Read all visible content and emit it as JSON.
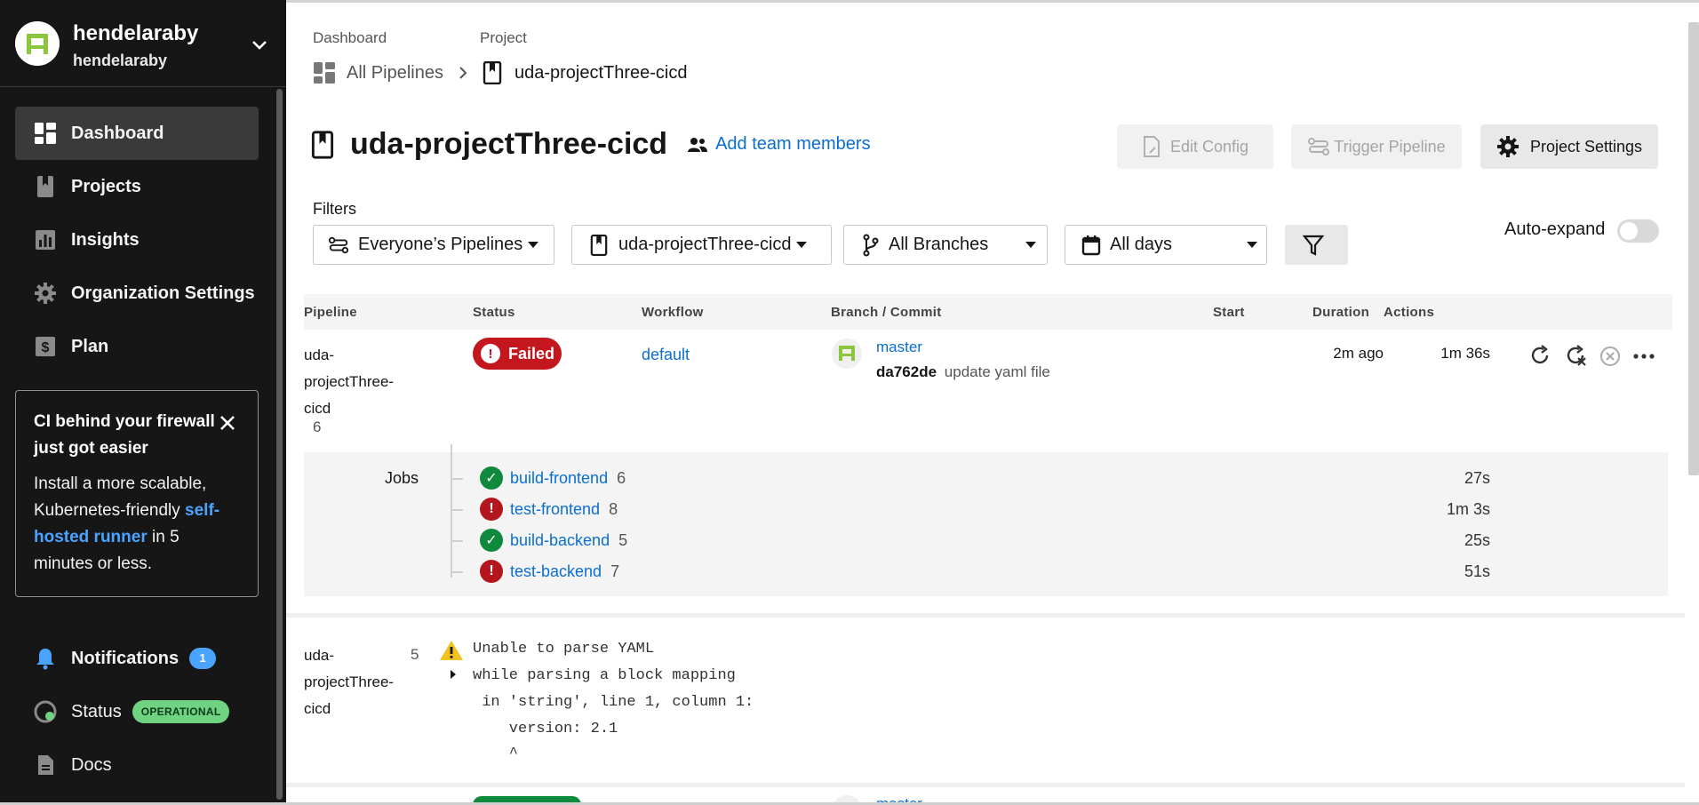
{
  "org": {
    "name": "hendelaraby",
    "sub": "hendelaraby"
  },
  "sidebar": {
    "items": [
      {
        "label": "Dashboard",
        "icon": "dashboard-icon"
      },
      {
        "label": "Projects",
        "icon": "projects-icon"
      },
      {
        "label": "Insights",
        "icon": "insights-icon"
      },
      {
        "label": "Organization Settings",
        "icon": "gear-icon"
      },
      {
        "label": "Plan",
        "icon": "dollar-icon"
      }
    ],
    "promo": {
      "title": "CI behind your firewall just got easier",
      "body_before": "Install a more scalable, Kubernetes-friendly ",
      "link": "self-hosted runner",
      "body_after": " in 5 minutes or less."
    },
    "bottom": {
      "notifications": "Notifications",
      "notifications_count": "1",
      "status": "Status",
      "status_badge": "OPERATIONAL",
      "docs": "Docs"
    }
  },
  "breadcrumb": {
    "dashboard_label": "Dashboard",
    "project_label": "Project",
    "all_pipelines": "All Pipelines",
    "project": "uda-projectThree-cicd"
  },
  "header": {
    "title": "uda-projectThree-cicd",
    "add_team": "Add team members",
    "edit_config": "Edit Config",
    "trigger_pipeline": "Trigger Pipeline",
    "project_settings": "Project Settings"
  },
  "filters": {
    "label": "Filters",
    "pipelines": "Everyone’s Pipelines",
    "project": "uda-projectThree-cicd",
    "branches": "All Branches",
    "days": "All days",
    "auto_expand": "Auto-expand"
  },
  "table": {
    "headers": [
      "Pipeline",
      "Status",
      "Workflow",
      "Branch / Commit",
      "Start",
      "Duration",
      "Actions"
    ]
  },
  "pipeline1": {
    "name_l1": "uda-",
    "name_l2": "projectThree-",
    "name_l3": "cicd",
    "number": "6",
    "status": "Failed",
    "workflow": "default",
    "branch": "master",
    "commit_hash": "da762de",
    "commit_msg": "update yaml file",
    "start": "2m ago",
    "duration": "1m 36s",
    "jobs_label": "Jobs",
    "jobs": [
      {
        "name": "build-frontend",
        "num": "6",
        "status": "success",
        "duration": "27s"
      },
      {
        "name": "test-frontend",
        "num": "8",
        "status": "failed",
        "duration": "1m 3s"
      },
      {
        "name": "build-backend",
        "num": "5",
        "status": "success",
        "duration": "25s"
      },
      {
        "name": "test-backend",
        "num": "7",
        "status": "failed",
        "duration": "51s"
      }
    ]
  },
  "pipeline2": {
    "name_l1": "uda-",
    "name_l2": "projectThree-",
    "name_l3": "cicd",
    "number": "5",
    "error_lines": [
      "Unable to parse YAML",
      "while parsing a block mapping",
      " in 'string', line 1, column 1:",
      "    version: 2.1",
      "    ^"
    ]
  },
  "pipeline3": {
    "branch": "master"
  },
  "colors": {
    "accent": "#0a6fd1",
    "failed": "#c4161d",
    "success": "#0f8a3c",
    "sidebar": "#161616"
  }
}
